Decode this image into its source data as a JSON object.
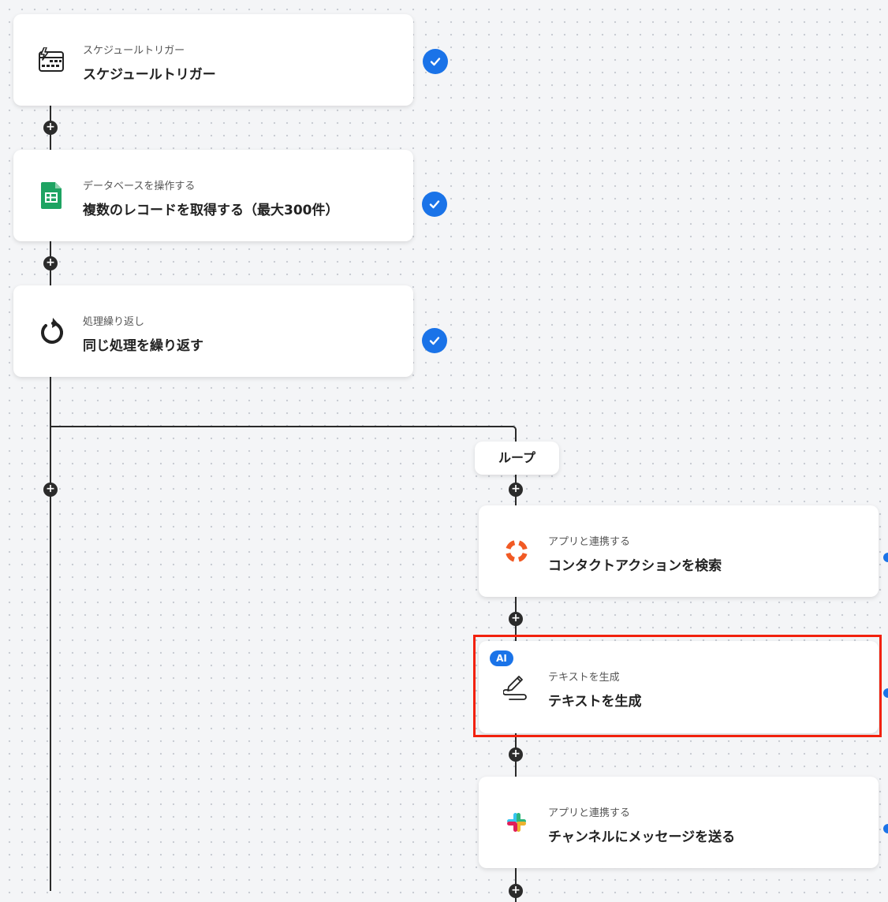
{
  "nodes": [
    {
      "subtitle": "スケジュールトリガー",
      "title": "スケジュールトリガー",
      "icon": "calendar-trigger-icon",
      "status": "completed"
    },
    {
      "subtitle": "データベースを操作する",
      "title": "複数のレコードを取得する（最大300件）",
      "icon": "google-sheets-icon",
      "status": "completed"
    },
    {
      "subtitle": "処理繰り返し",
      "title": "同じ処理を繰り返す",
      "icon": "loop-arrow-icon",
      "status": "completed"
    },
    {
      "subtitle": "アプリと連携する",
      "title": "コンタクトアクションを検索",
      "icon": "lifebuoy-icon"
    },
    {
      "subtitle": "テキストを生成",
      "title": "テキストを生成",
      "icon": "ai-pen-icon",
      "badge": "AI",
      "highlighted": true
    },
    {
      "subtitle": "アプリと連携する",
      "title": "チャンネルにメッセージを送る",
      "icon": "slack-icon"
    }
  ],
  "loop_label": "ループ",
  "colors": {
    "accent": "#1a73e8",
    "highlight": "#f2210d",
    "line": "#2a2a2a",
    "sheets_green": "#1ea362",
    "lifebuoy_orange": "#f15a24"
  }
}
